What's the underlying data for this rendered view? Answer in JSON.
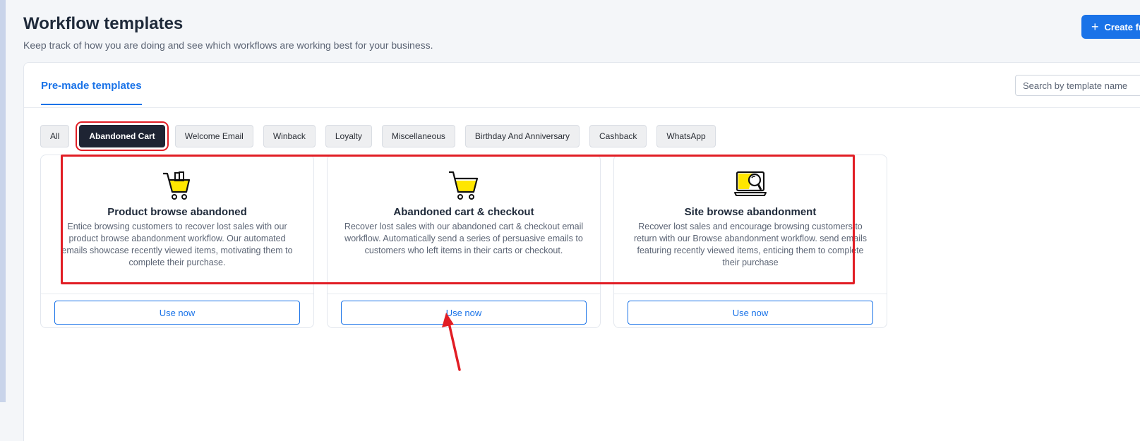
{
  "header": {
    "title": "Workflow templates",
    "subtitle": "Keep track of how you are doing and see which workflows are working best for your business.",
    "create_button_label": "Create fr"
  },
  "tabs": {
    "active_label": "Pre-made templates"
  },
  "search": {
    "placeholder": "Search by template name"
  },
  "filters": [
    {
      "label": "All",
      "active": false
    },
    {
      "label": "Abandoned Cart",
      "active": true
    },
    {
      "label": "Welcome Email",
      "active": false
    },
    {
      "label": "Winback",
      "active": false
    },
    {
      "label": "Loyalty",
      "active": false
    },
    {
      "label": "Miscellaneous",
      "active": false
    },
    {
      "label": "Birthday And Anniversary",
      "active": false
    },
    {
      "label": "Cashback",
      "active": false
    },
    {
      "label": "WhatsApp",
      "active": false
    }
  ],
  "cards": [
    {
      "icon": "shopping-bags-cart-icon",
      "title": "Product browse abandoned",
      "description": "Entice browsing customers to recover lost sales with our product browse abandonment workflow. Our automated emails showcase recently viewed items, motivating them to complete their purchase.",
      "button_label": "Use now"
    },
    {
      "icon": "shopping-cart-icon",
      "title": "Abandoned cart & checkout",
      "description": "Recover lost sales with our abandoned cart & checkout email workflow. Automatically send a series of persuasive emails to customers who left items in their carts or checkout.",
      "button_label": "Use now"
    },
    {
      "icon": "laptop-magnifier-icon",
      "title": "Site browse abandonment",
      "description": "Recover lost sales and encourage browsing customers to return with our Browse abandonment workflow. send emails featuring recently viewed items, enticing them to complete their purchase",
      "button_label": "Use now"
    }
  ],
  "colors": {
    "accent": "#1a73e8",
    "annotation": "#e11d24",
    "icon_fill": "#ffe600"
  }
}
